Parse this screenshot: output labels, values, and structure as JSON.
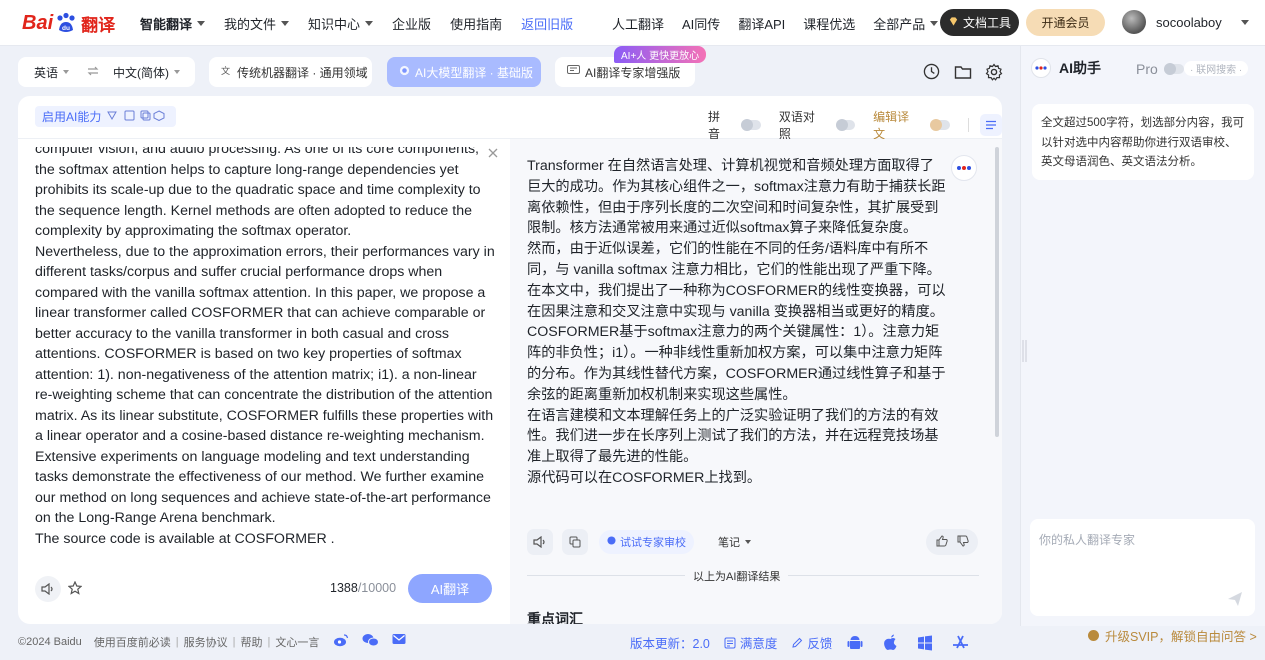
{
  "nav": {
    "logo_text": "Bai",
    "logo_du": "du",
    "logo_product": "翻译",
    "menu": [
      {
        "label": "智能翻译",
        "bold": true,
        "caret": true
      },
      {
        "label": "我的文件",
        "caret": true
      },
      {
        "label": "知识中心",
        "caret": true
      },
      {
        "label": "企业版"
      },
      {
        "label": "使用指南"
      },
      {
        "label": "返回旧版",
        "blue": true
      }
    ],
    "right_menu": [
      "人工翻译",
      "AI同传",
      "翻译API",
      "课程优选",
      "全部产品"
    ],
    "doc_tool": "文档工具",
    "vip": "开通会员",
    "username": "socoolaboy"
  },
  "toolbar": {
    "source_lang": "英语",
    "target_lang": "中文(简体)",
    "mode_traditional": "传统机器翻译 · 通用领域",
    "mode_ai": "AI大模型翻译 · 基础版",
    "mode_expert": "AI翻译专家增强版",
    "hot_badge": "AI+人 更快更放心"
  },
  "panel": {
    "enable_ai": "启用AI能力",
    "pinyin": "拼音",
    "bilingual": "双语对照",
    "edit": "编辑译文",
    "source_paragraphs": [
      "computer vision, and audio processing. As one of its core components, the softmax attention helps to capture long-range dependencies yet prohibits its scale-up due to the quadratic space and time complexity to the sequence length. Kernel methods are often adopted to reduce the complexity by approximating the softmax operator.",
      "Nevertheless, due to the approximation errors, their performances vary in different tasks/corpus and suffer crucial performance drops when compared with the vanilla softmax attention. In this paper, we propose a linear transformer called COSFORMER that can achieve comparable or better accuracy to the vanilla transformer in both casual and cross attentions. COSFORMER is based on two key properties of softmax attention: 1). non-negativeness of the attention matrix; i1). a non-linear re-weighting scheme that can concentrate the distribution of the attention matrix. As its linear substitute, COSFORMER fulfills these properties with a linear operator and a cosine-based distance re-weighting mechanism.",
      "Extensive experiments on language modeling and text understanding tasks demonstrate the effectiveness of our method. We further examine our method on long sequences and achieve state-of-the-art performance on the Long-Range Arena benchmark.",
      "The source code is available at COSFORMER ."
    ],
    "char_count": "1388",
    "char_max": "/10000",
    "translate_button": "AI翻译",
    "target_paragraphs": [
      "Transformer 在自然语言处理、计算机视觉和音频处理方面取得了巨大的成功。作为其核心组件之一，softmax注意力有助于捕获长距离依赖性，但由于序列长度的二次空间和时间复杂性，其扩展受到限制。核方法通常被用来通过近似softmax算子来降低复杂度。",
      "然而，由于近似误差，它们的性能在不同的任务/语料库中有所不同，与 vanilla softmax 注意力相比，它们的性能出现了严重下降。",
      "在本文中，我们提出了一种称为COSFORMER的线性变换器，可以在因果注意和交叉注意中实现与 vanilla 变换器相当或更好的精度。COSFORMER基于softmax注意力的两个关键属性：1）。注意力矩阵的非负性；i1）。一种非线性重新加权方案，可以集中注意力矩阵的分布。作为其线性替代方案，COSFORMER通过线性算子和基于余弦的距离重新加权机制来实现这些属性。",
      "在语言建模和文本理解任务上的广泛实验证明了我们的方法的有效性。我们进一步在长序列上测试了我们的方法，并在远程竞技场基准上取得了最先进的性能。",
      "源代码可以在COSFORMER上找到。"
    ],
    "expert_review": "试试专家审校",
    "notes": "笔记",
    "result_divider": "以上为AI翻译结果",
    "key_vocab": "重点词汇"
  },
  "sidebar": {
    "title": "AI助手",
    "pro": "Pro",
    "net_search": "· 联网搜索 ·",
    "tip": "全文超过500字符，划选部分内容，我可以针对选中内容帮助你进行双语审校、英文母语润色、英文语法分析。",
    "ask_placeholder": "你的私人翻译专家",
    "upgrade": "升级SVIP，解锁自由问答 >"
  },
  "footer": {
    "copyright": "©2024 Baidu",
    "links": [
      "使用百度前必读",
      "服务协议",
      "帮助",
      "文心一言"
    ],
    "version": "版本更新：2.0",
    "satisfaction": "满意度",
    "feedback": "反馈"
  },
  "colors": {
    "brand_red": "#e1251b",
    "accent_blue": "#4a6cf7",
    "gold": "#b98a3c"
  }
}
